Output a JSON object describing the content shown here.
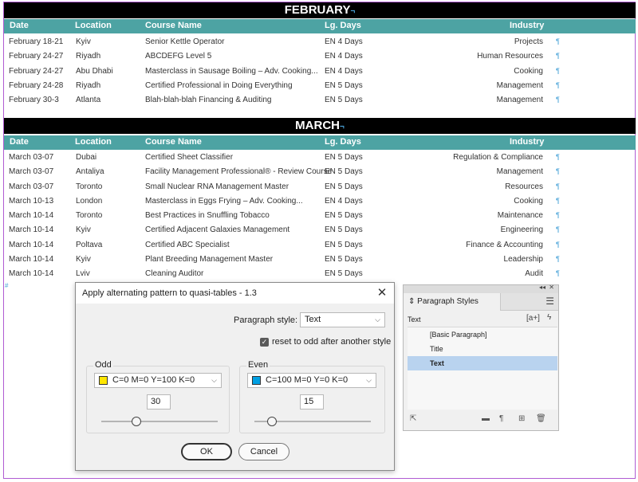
{
  "february": {
    "title": "FEBRUARY",
    "headers": [
      "Date",
      "Location",
      "Course Name",
      "Lg. Days",
      "Industry"
    ],
    "rows": [
      [
        "February 18-21",
        "Kyiv",
        "Senior Kettle Operator",
        "EN 4 Days",
        "Projects"
      ],
      [
        "February 24-27",
        "Riyadh",
        "ABCDEFG Level 5",
        "EN 4 Days",
        "Human Resources"
      ],
      [
        "February 24-27",
        "Abu Dhabi",
        "Masterclass in Sausage Boiling – Adv. Cooking...",
        "EN 4 Days",
        "Cooking"
      ],
      [
        "February 24-28",
        "Riyadh",
        "Certified Professional in Doing Everything",
        "EN 5 Days",
        "Management"
      ],
      [
        "February 30-3",
        "Atlanta",
        "Blah-blah-blah Financing & Auditing",
        "EN 5 Days",
        "Management"
      ]
    ]
  },
  "march": {
    "title": "MARCH",
    "headers": [
      "Date",
      "Location",
      "Course Name",
      "Lg. Days",
      "Industry"
    ],
    "rows": [
      [
        "March 03-07",
        "Dubai",
        "Certified Sheet Classifier",
        "EN 5 Days",
        "Regulation & Compliance"
      ],
      [
        "March 03-07",
        "Antaliya",
        "Facility Management Professional® - Review Course",
        "EN 5 Days",
        "Management"
      ],
      [
        "March 03-07",
        "Toronto",
        "Small Nuclear RNA Management Master",
        "EN 5 Days",
        "Resources"
      ],
      [
        "March 10-13",
        "London",
        "Masterclass in Eggs Frying – Adv. Cooking...",
        "EN 4 Days",
        "Cooking"
      ],
      [
        "March 10-14",
        "Toronto",
        "Best Practices in Snuffling Tobacco",
        "EN 5 Days",
        "Maintenance"
      ],
      [
        "March 10-14",
        "Kyiv",
        "Certified Adjacent Galaxies Management",
        "EN 5 Days",
        "Engineering"
      ],
      [
        "March 10-14",
        "Poltava",
        "Certified ABC Specialist",
        "EN 5 Days",
        "Finance & Accounting"
      ],
      [
        "March 10-14",
        "Kyiv",
        "Plant Breeding Management Master",
        "EN 5 Days",
        "Leadership"
      ],
      [
        "March 10-14",
        "Lviv",
        "Cleaning Auditor",
        "EN 5 Days",
        "Audit"
      ]
    ]
  },
  "dialog": {
    "title": "Apply alternating pattern to quasi-tables - 1.3",
    "close_glyph": "✕",
    "para_style_label": "Paragraph style:",
    "para_style_value": "Text",
    "reset_label": "reset to odd after another style",
    "reset_checked": true,
    "odd": {
      "label": "Odd",
      "swatch_label": "C=0 M=0 Y=100 K=0",
      "swatch_color": "#ffe600",
      "tint": "30",
      "slider_fraction": 0.3
    },
    "even": {
      "label": "Even",
      "swatch_label": "C=100 M=0 Y=0 K=0",
      "swatch_color": "#00a0e3",
      "tint": "15",
      "slider_fraction": 0.15
    },
    "ok_label": "OK",
    "cancel_label": "Cancel"
  },
  "panel": {
    "title": "Paragraph Styles",
    "current_style": "Text",
    "styles": [
      "[Basic Paragraph]",
      "Title",
      "Text"
    ],
    "selected_style": "Text"
  }
}
